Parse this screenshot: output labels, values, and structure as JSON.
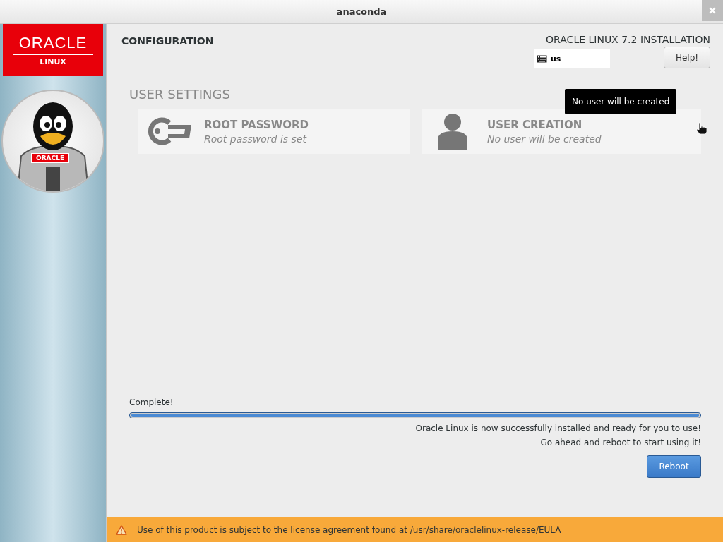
{
  "window": {
    "title": "anaconda"
  },
  "sidebar": {
    "logo_top": "ORACLE",
    "logo_bottom": "LINUX",
    "mascot_badge": "ORACLE"
  },
  "header": {
    "section": "CONFIGURATION",
    "product": "ORACLE LINUX 7.2 INSTALLATION",
    "keyboard": "us",
    "help": "Help!"
  },
  "user_settings": {
    "title": "USER SETTINGS",
    "spokes": [
      {
        "kind": "key",
        "title": "ROOT PASSWORD",
        "status": "Root password is set"
      },
      {
        "kind": "user",
        "title": "USER CREATION",
        "status": "No user will be created"
      }
    ]
  },
  "tooltip": "No user will be created",
  "progress": {
    "label": "Complete!",
    "level": 1.0,
    "messages": [
      "Oracle Linux is now successfully installed and ready for you to use!",
      "Go ahead and reboot to start using it!"
    ],
    "button": "Reboot"
  },
  "warning_bar": {
    "text": "Use of this product is subject to the license agreement found at /usr/share/oraclelinux-release/EULA"
  }
}
